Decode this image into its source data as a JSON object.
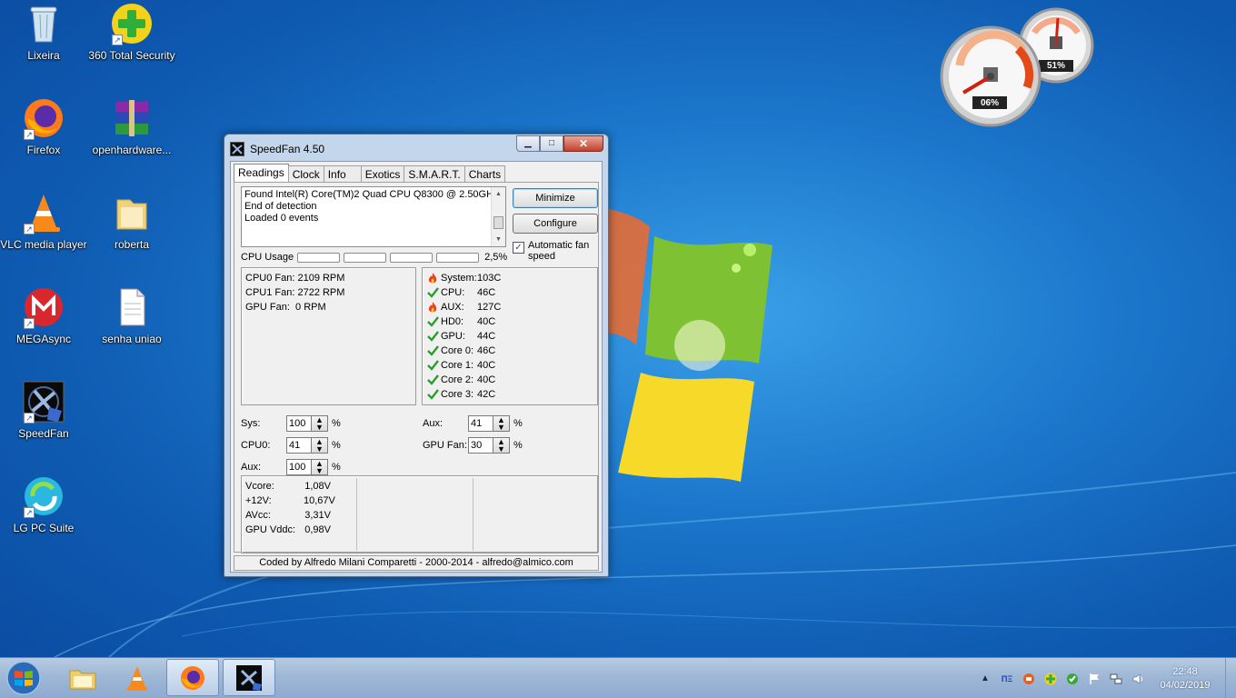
{
  "desktop": {
    "icons": [
      {
        "label": "Lixeira"
      },
      {
        "label": "360 Total Security"
      },
      {
        "label": "Firefox"
      },
      {
        "label": "openhardware..."
      },
      {
        "label": "VLC media player"
      },
      {
        "label": "roberta"
      },
      {
        "label": "MEGAsync"
      },
      {
        "label": "senha uniao"
      },
      {
        "label": "SpeedFan"
      },
      {
        "label": "LG PC Suite"
      }
    ]
  },
  "gadget": {
    "cpu_percent": "06%",
    "memory_percent": "51%"
  },
  "window": {
    "title": "SpeedFan 4.50",
    "tabs": [
      "Readings",
      "Clock",
      "Info",
      "Exotics",
      "S.M.A.R.T.",
      "Charts"
    ],
    "log_lines": [
      "Found Intel(R) Core(TM)2 Quad CPU Q8300 @ 2.50GHz",
      "End of detection",
      "Loaded 0 events"
    ],
    "buttons": {
      "minimize": "Minimize",
      "configure": "Configure"
    },
    "auto_fan": {
      "label": "Automatic fan speed",
      "checked": true
    },
    "cpu_usage": {
      "label": "CPU Usage",
      "value": "2,5%",
      "bars": [
        0,
        0,
        0,
        0
      ]
    },
    "fans": [
      "CPU0 Fan: 2109 RPM",
      "CPU1 Fan: 2722 RPM",
      "GPU Fan:  0 RPM"
    ],
    "temps": [
      {
        "label": "System:",
        "value": "103C",
        "status": "hot"
      },
      {
        "label": "CPU:",
        "value": "46C",
        "status": "ok"
      },
      {
        "label": "AUX:",
        "value": "127C",
        "status": "hot"
      },
      {
        "label": "HD0:",
        "value": "40C",
        "status": "ok"
      },
      {
        "label": "GPU:",
        "value": "44C",
        "status": "ok"
      },
      {
        "label": "Core 0:",
        "value": "46C",
        "status": "ok"
      },
      {
        "label": "Core 1:",
        "value": "40C",
        "status": "ok"
      },
      {
        "label": "Core 2:",
        "value": "40C",
        "status": "ok"
      },
      {
        "label": "Core 3:",
        "value": "42C",
        "status": "ok"
      }
    ],
    "speeds": {
      "sys": {
        "label": "Sys:",
        "value": "100"
      },
      "cpu0": {
        "label": "CPU0:",
        "value": "41"
      },
      "aux1": {
        "label": "Aux:",
        "value": "100"
      },
      "aux2": {
        "label": "Aux:",
        "value": "41"
      },
      "gpufan": {
        "label": "GPU Fan:",
        "value": "30"
      },
      "unit": "%"
    },
    "voltages": [
      {
        "label": "Vcore:",
        "value": "1,08V"
      },
      {
        "label": "+12V:",
        "value": "10,67V"
      },
      {
        "label": "AVcc:",
        "value": "3,31V"
      },
      {
        "label": "GPU Vddc:",
        "value": "0,98V"
      }
    ],
    "status": "Coded by Alfredo Milani Comparetti - 2000-2014 - alfredo@almico.com"
  },
  "taskbar": {
    "tray_badge": "ΠΞ",
    "time": "22:48",
    "date": "04/02/2019"
  },
  "colors": {
    "hot": "#e2471b",
    "ok": "#2f9a2f",
    "taskbar": "#9fb8d6"
  }
}
